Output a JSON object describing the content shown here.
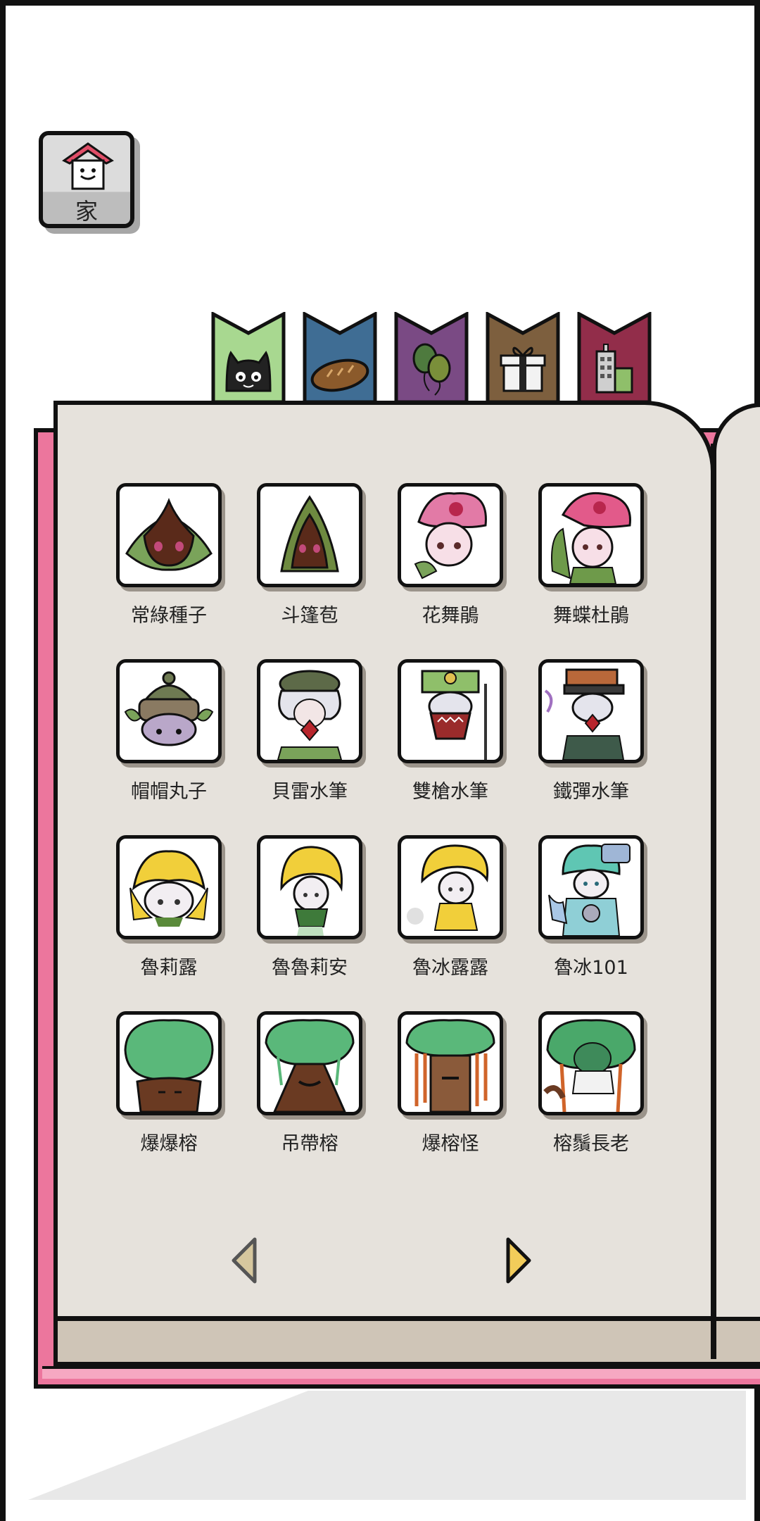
{
  "home": {
    "label": "家",
    "icon": "house-icon"
  },
  "bookmarks": [
    {
      "icon": "cat-icon",
      "color": "#a8d890"
    },
    {
      "icon": "bread-icon",
      "color": "#3f6d94"
    },
    {
      "icon": "balloon-icon",
      "color": "#7a4a84"
    },
    {
      "icon": "gift-icon",
      "color": "#7d5f3e"
    },
    {
      "icon": "building-icon",
      "color": "#922d4a"
    }
  ],
  "monsters": [
    {
      "name": "常綠種子",
      "art": "seed-round"
    },
    {
      "name": "斗篷苞",
      "art": "seed-hood"
    },
    {
      "name": "花舞鵑",
      "art": "pink-flower"
    },
    {
      "name": "舞蝶杜鵑",
      "art": "pink-flower-girl"
    },
    {
      "name": "帽帽丸子",
      "art": "hat-ball"
    },
    {
      "name": "貝雷水筆",
      "art": "beret-kid"
    },
    {
      "name": "雙槍水筆",
      "art": "spear-kid"
    },
    {
      "name": "鐵彈水筆",
      "art": "cap-kid"
    },
    {
      "name": "魯莉露",
      "art": "yellow-bud"
    },
    {
      "name": "魯魯莉安",
      "art": "yellow-girl"
    },
    {
      "name": "魯冰露露",
      "art": "yellow-fairy"
    },
    {
      "name": "魯冰101",
      "art": "cyan-robot"
    },
    {
      "name": "爆爆榕",
      "art": "tree-round"
    },
    {
      "name": "吊帶榕",
      "art": "tree-strap"
    },
    {
      "name": "爆榕怪",
      "art": "tree-monster"
    },
    {
      "name": "榕鬚長老",
      "art": "tree-elder"
    }
  ],
  "nav": {
    "prev_icon": "arrow-left-icon",
    "next_icon": "arrow-right-icon"
  },
  "colors": {
    "book_cover": "#ec769d",
    "page": "#e6e2dc",
    "outline": "#111111"
  }
}
